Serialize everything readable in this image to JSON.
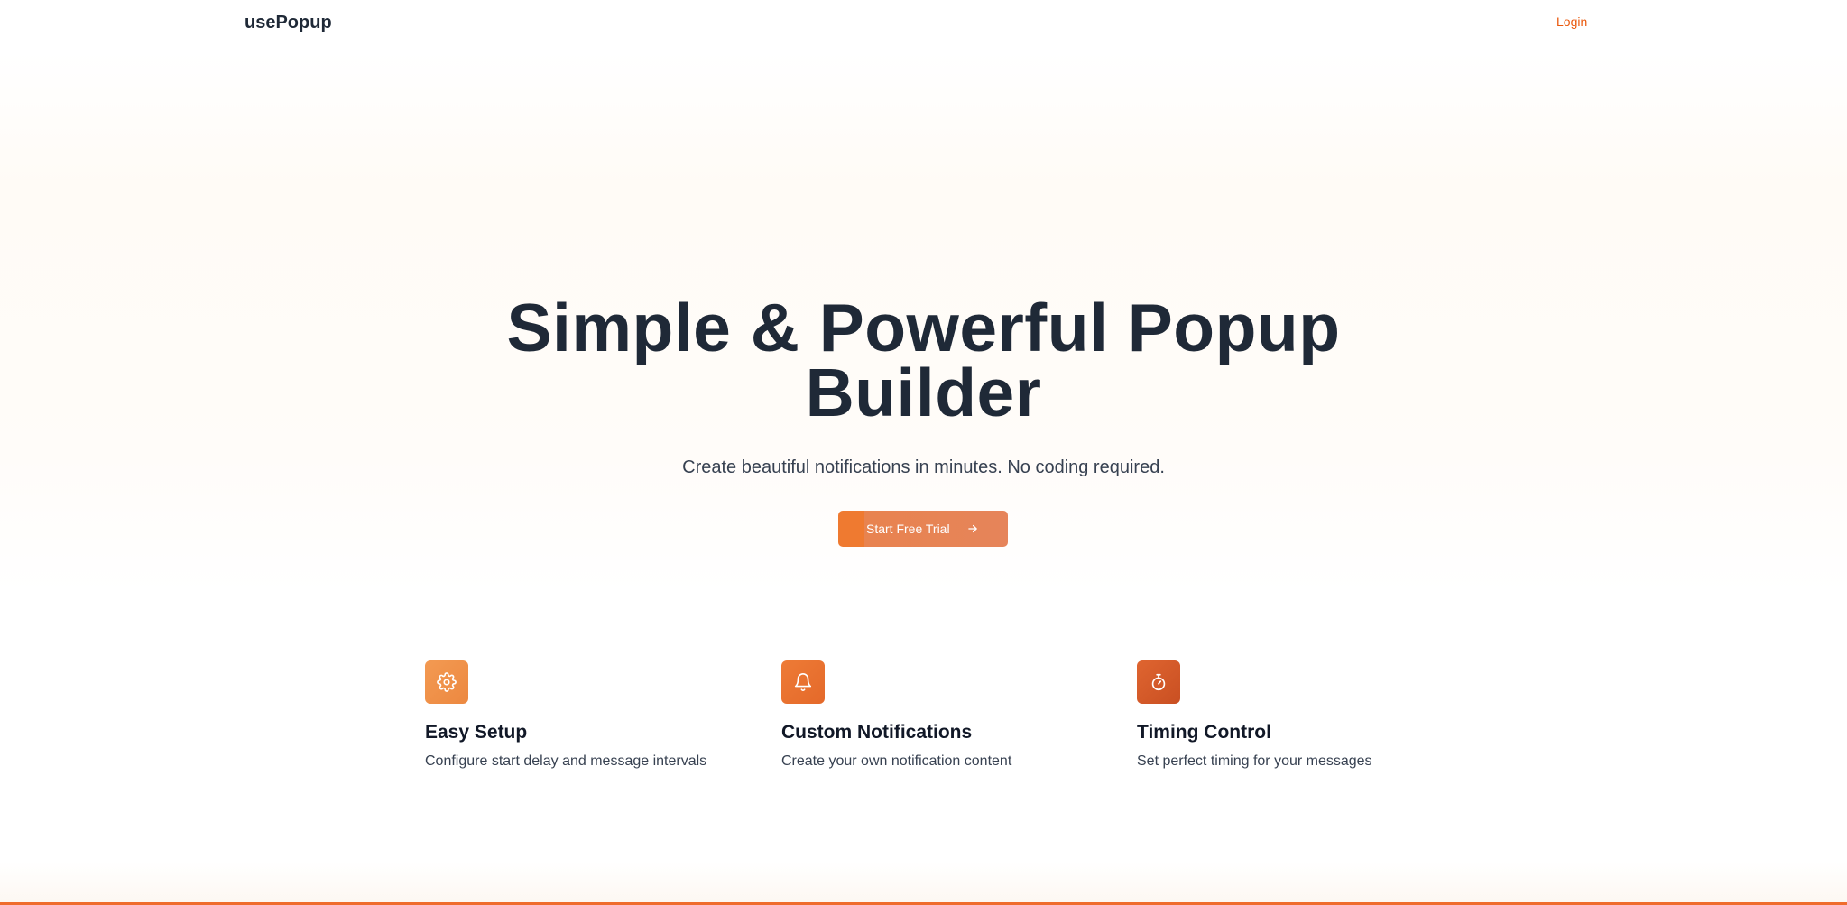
{
  "header": {
    "brand": "usePopup",
    "login_label": "Login"
  },
  "hero": {
    "title_line1": "Simple & Powerful Popup",
    "title_line2": "Builder",
    "subtitle": "Create beautiful notifications in minutes. No coding required.",
    "cta_label": "Start Free Trial",
    "cta_icon": "arrow-right-icon"
  },
  "features": [
    {
      "icon": "gear-icon",
      "icon_color": "#f0904a",
      "title": "Easy Setup",
      "description": "Configure start delay and message intervals"
    },
    {
      "icon": "bell-icon",
      "icon_color": "#eb7231",
      "title": "Custom Notifications",
      "description": "Create your own notification content"
    },
    {
      "icon": "stopwatch-icon",
      "icon_color": "#d95b29",
      "title": "Timing Control",
      "description": "Set perfect timing for your messages"
    }
  ],
  "colors": {
    "accent": "#ea580c",
    "button": "#e8834f",
    "text_dark": "#1f2937"
  }
}
